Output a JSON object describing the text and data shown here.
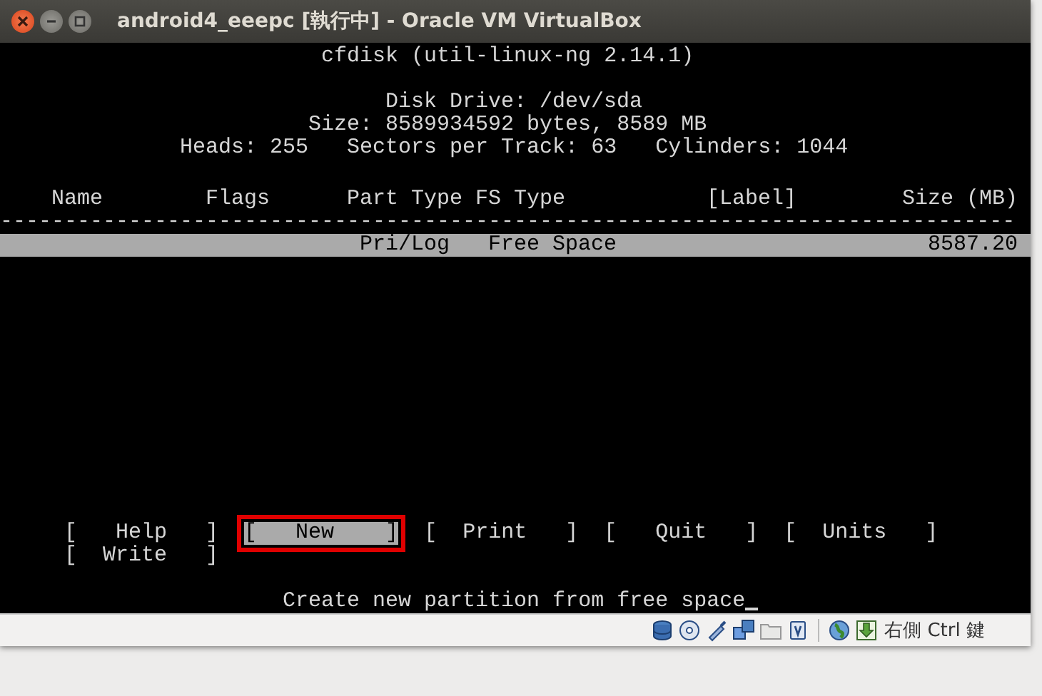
{
  "window": {
    "title": "android4_eeepc [執行中] - Oracle VM VirtualBox"
  },
  "terminal": {
    "program_title": "cfdisk (util-linux-ng 2.14.1)",
    "disk_drive": "Disk Drive: /dev/sda",
    "size": "Size: 8589934592 bytes, 8589 MB",
    "geometry": "Heads: 255   Sectors per Track: 63   Cylinders: 1044",
    "columns": [
      "Name",
      "Flags",
      "Part Type",
      "FS Type",
      "[Label]",
      "Size (MB)"
    ],
    "separator": "-------------------------------------------------------------------------------",
    "partitions": [
      {
        "part_type": "Pri/Log",
        "fs_type": "Free Space",
        "size": "8587.20",
        "selected": true
      }
    ],
    "menu": [
      {
        "label": "[   Help   ]",
        "selected": false
      },
      {
        "label": "[   New    ]",
        "selected": true
      },
      {
        "label": "[  Print   ]",
        "selected": false
      },
      {
        "label": "[   Quit   ]",
        "selected": false
      },
      {
        "label": "[  Units   ]",
        "selected": false
      },
      {
        "label": "[  Write   ]",
        "selected": false
      }
    ],
    "message": "Create new partition from free space"
  },
  "status_bar": {
    "host_key": "右側 Ctrl 鍵"
  }
}
